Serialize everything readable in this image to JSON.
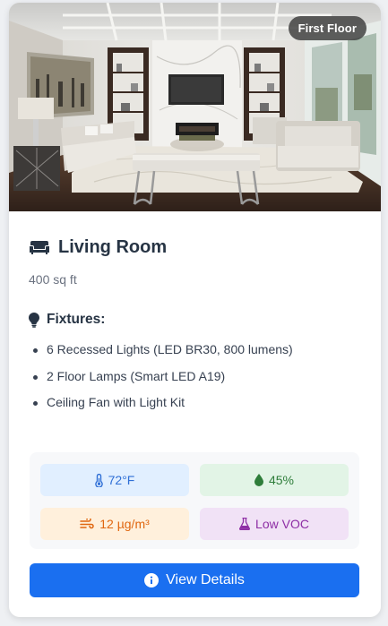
{
  "room": {
    "floor_badge": "First Floor",
    "name": "Living Room",
    "area": "400 sq ft"
  },
  "fixtures": {
    "heading": "Fixtures:",
    "items": [
      "6 Recessed Lights (LED BR30, 800 lumens)",
      "2 Floor Lamps (Smart LED A19)",
      "Ceiling Fan with Light Kit"
    ]
  },
  "environment": {
    "temperature": "72°F",
    "humidity": "45%",
    "particulates": "12 µg/m³",
    "voc": "Low VOC"
  },
  "actions": {
    "details_label": "View Details"
  },
  "icons": {
    "room": "couch-icon",
    "fixtures": "lightbulb-icon",
    "temperature": "thermometer-icon",
    "humidity": "droplet-icon",
    "particulates": "wind-icon",
    "voc": "flask-icon",
    "details": "info-circle-icon"
  },
  "colors": {
    "primary": "#1a6ff0",
    "title": "#273444",
    "temperature": "#2f6fd6",
    "humidity": "#2e7d3a",
    "particulates": "#e0660f",
    "voc": "#8e2ea5"
  }
}
